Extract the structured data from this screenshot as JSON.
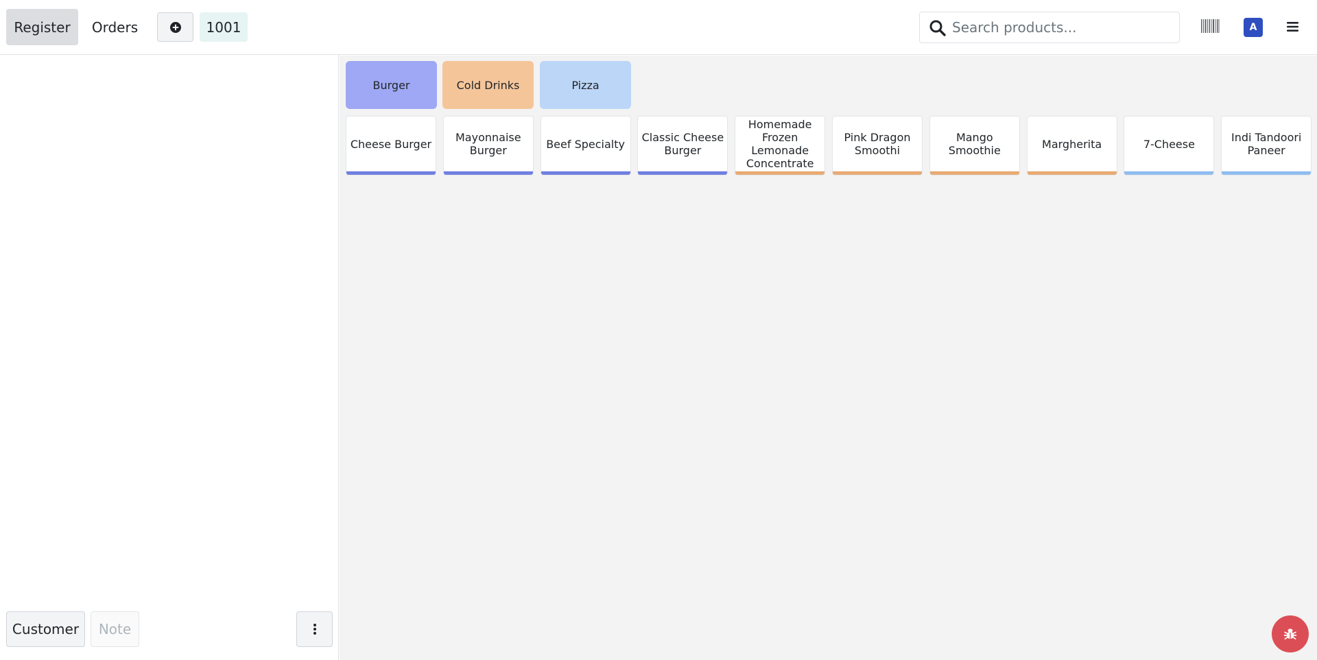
{
  "header": {
    "nav": [
      {
        "label": "Register",
        "active": true
      },
      {
        "label": "Orders",
        "active": false
      }
    ],
    "order_tab": "1001",
    "search": {
      "placeholder": "Search products...",
      "value": ""
    },
    "avatar_letter": "A",
    "icons": {
      "new_order": "plus-circle-icon",
      "search": "search-icon",
      "barcode": "barcode-icon",
      "menu": "hamburger-menu-icon"
    }
  },
  "left_panel": {
    "customer_label": "Customer",
    "note_label": "Note",
    "more_icon": "vertical-dots-icon"
  },
  "categories": [
    {
      "label": "Burger",
      "color": "#9fa8f4"
    },
    {
      "label": "Cold Drinks",
      "color": "#f5c59a"
    },
    {
      "label": "Pizza",
      "color": "#bcd6f7"
    }
  ],
  "products": [
    {
      "name": "Cheese Burger",
      "category": "Burger",
      "color": "#717fe0"
    },
    {
      "name": "Mayonnaise Burger",
      "category": "Burger",
      "color": "#717fe0"
    },
    {
      "name": "Beef Specialty",
      "category": "Burger",
      "color": "#717fe0"
    },
    {
      "name": "Classic Cheese Burger",
      "category": "Burger",
      "color": "#717fe0"
    },
    {
      "name": "Homemade Frozen Lemonade Concentrate",
      "category": "Cold Drinks",
      "color": "#e8aa74"
    },
    {
      "name": "Pink Dragon Smoothi",
      "category": "Cold Drinks",
      "color": "#e8aa74"
    },
    {
      "name": "Mango Smoothie",
      "category": "Cold Drinks",
      "color": "#e8aa74"
    },
    {
      "name": "Margherita",
      "category": "Pizza",
      "color": "#e8aa74"
    },
    {
      "name": "7-Cheese",
      "category": "Pizza",
      "color": "#8fbdee"
    },
    {
      "name": "Indi Tandoori Paneer",
      "category": "Pizza",
      "color": "#8fbdee"
    }
  ],
  "debug_icon": "bug-icon",
  "colors": {
    "accent": "#2f4ec0",
    "debug": "#dc4e55"
  }
}
